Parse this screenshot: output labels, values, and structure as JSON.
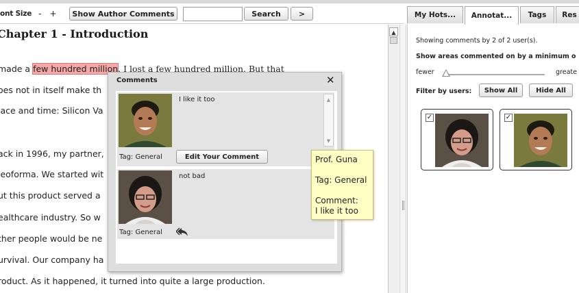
{
  "toolbar": {
    "font_size_label": "ont Size",
    "font_decrease": "-",
    "font_increase": "+",
    "show_author_comments": "Show Author Comments",
    "search_value": "",
    "search_placeholder": "",
    "search_label": "Search",
    "next_label": ">"
  },
  "reader": {
    "chapter_title": "Chapter 1 - Introduction",
    "line1_before": "made a ",
    "line1_highlight": "few hundred million",
    "line1_after": ". I lost a few hundred million. But that",
    "lines": [
      "oes not in itself make th",
      "lace and time: Silicon Va",
      "ack in 1996, my partner,",
      "leoforma. We started wit",
      "ut this product served a",
      "ealthcare industry. So w",
      "ther people would be ne",
      "urvival. Our company ha",
      "roduct. As it happened, it turned into quite a large production."
    ]
  },
  "tabs": [
    "My Hots...",
    "Annotat...",
    "Tags",
    "Res"
  ],
  "active_tab": 1,
  "panel": {
    "showing": "Showing comments by 2 of 2 user(s).",
    "areas": "Show areas commented on by a minimum o",
    "fewer": "fewer",
    "greater": "greate",
    "filter_label": "Filter by users:",
    "show_all": "Show All",
    "hide_all": "Hide All",
    "user_checkbox_mark": "✓"
  },
  "popup": {
    "title": "Comments",
    "close": "✕",
    "comments": [
      {
        "text": "I like it too",
        "tag": "Tag: General",
        "action": "Edit Your Comment"
      },
      {
        "text": "not bad",
        "tag": "Tag: General"
      }
    ],
    "scroll_up": "▲",
    "scroll_down": "▼"
  },
  "tooltip": {
    "name": "Prof. Guna",
    "tag": "Tag: General",
    "comment_label": "Comment:",
    "comment_text": "I like it too"
  },
  "scrollbar": {
    "up": "▲"
  },
  "colors": {
    "highlight": "#f6a7a7",
    "tooltip_bg": "#ffffc6",
    "popup_bg": "#dedede"
  }
}
